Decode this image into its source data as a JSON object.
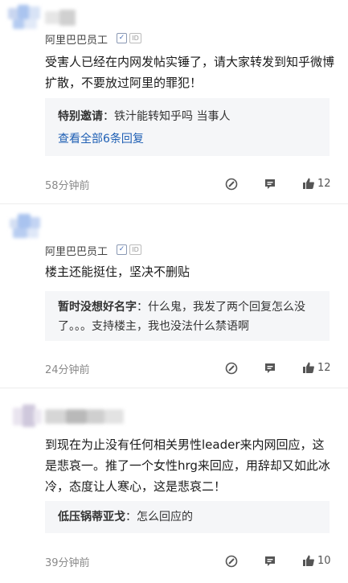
{
  "posts": [
    {
      "author": "阿里巴巴员工",
      "id_badge": "ID",
      "content": "受害人已经在内网发帖实锤了，请大家转发到知乎微博扩散，不要放过阿里的罪犯！",
      "reply": {
        "name": "特别邀请",
        "sep": "：",
        "text": "铁汁能转知乎吗 当事人"
      },
      "more": "查看全部6条回复",
      "time": "58分钟前",
      "likes": "12"
    },
    {
      "author": "阿里巴巴员工",
      "id_badge": "ID",
      "content": "楼主还能挺住，坚决不删贴",
      "reply": {
        "name": "暂时没想好名字",
        "sep": "：",
        "text": "什么鬼，我发了两个回复怎么没了。。。支持楼主，我也没法什么禁语啊"
      },
      "time": "24分钟前",
      "likes": "12"
    },
    {
      "content": "到现在为止没有任何相关男性leader来内网回应，这是悲哀一。推了一个女性hrg来回应，用辞却又如此冰冷，态度让人寒心，这是悲哀二！",
      "reply": {
        "name": "低压锅蒂亚戈",
        "sep": "：",
        "text": "怎么回应的"
      },
      "time": "39分钟前",
      "likes": "10"
    }
  ],
  "icons": {
    "edit": "edit-icon",
    "comment": "comment-icon",
    "like": "thumbs-up-icon"
  },
  "colors": {
    "link": "#1e5fb4",
    "reply_bg": "#f5f6f8",
    "muted": "#8a8a8a"
  }
}
